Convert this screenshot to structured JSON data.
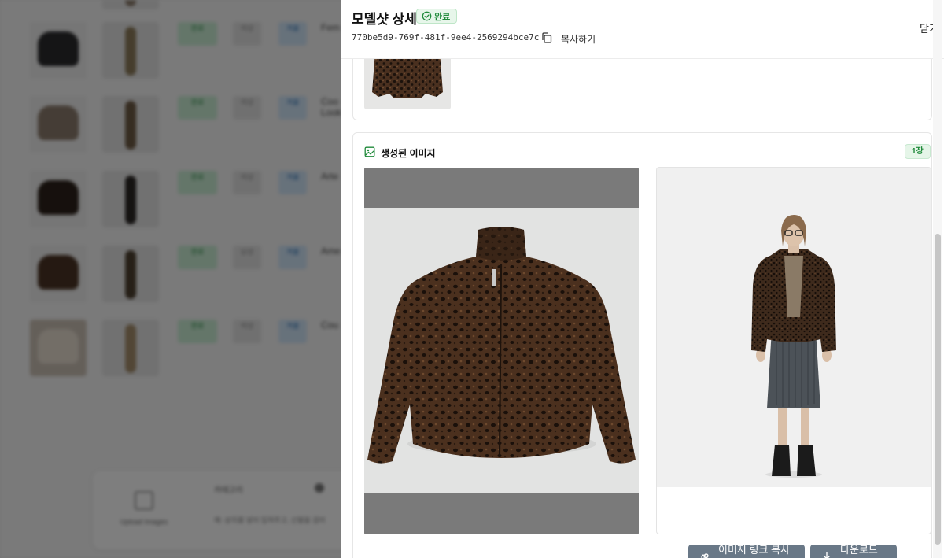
{
  "drawer": {
    "title": "모델샷 상세",
    "status": "완료",
    "uuid": "770be5d9-769f-481f-9ee4-2569294bce7c",
    "copy_label": "복사하기",
    "close_label": "닫기"
  },
  "generated": {
    "title": "생성된 이미지",
    "count": "1장",
    "copy_link_label": "이미지 링크 복사하기",
    "download_label": "다운로드하기"
  },
  "background": {
    "rows": [
      {
        "name": "Fem",
        "chip1": "완료",
        "chip2": "여성",
        "chip3": "겨울"
      },
      {
        "name": "Coo Look",
        "chip1": "완료",
        "chip2": "여성",
        "chip3": "겨울"
      },
      {
        "name": "Arte",
        "chip1": "완료",
        "chip2": "여성",
        "chip3": "겨울"
      },
      {
        "name": "Ame",
        "chip1": "완료",
        "chip2": "남성",
        "chip3": "겨울"
      },
      {
        "name": "Cou",
        "chip1": "완료",
        "chip2": "여성",
        "chip3": "겨울"
      }
    ],
    "upload_label": "Upload Images",
    "category_label": "카테고리",
    "prompt_hint": "예: 상의를 넣어 입혀주고, 신발을 검어"
  },
  "colors": {
    "status_green": "#1f8a3a",
    "button_bg": "#697887",
    "fur_brown": "#3b2a1e"
  }
}
